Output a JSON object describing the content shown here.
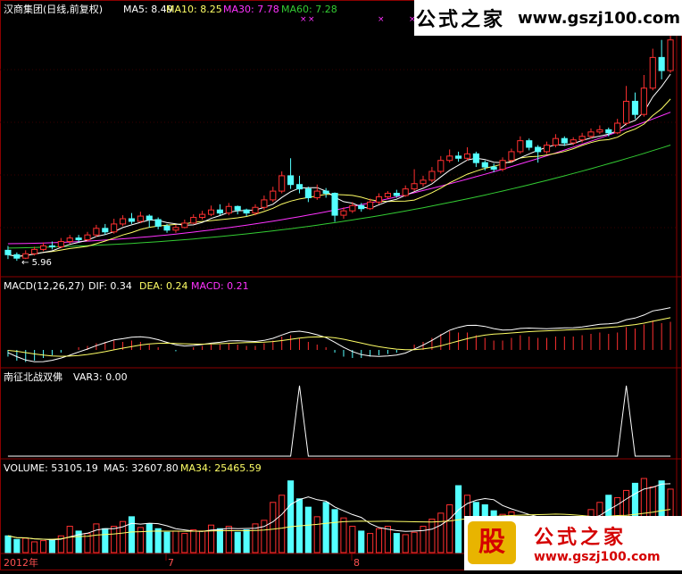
{
  "colors": {
    "background": "#000000",
    "border": "#8b0000",
    "up": "#ff3030",
    "down": "#54ffff",
    "ma5": "#ffffff",
    "ma10": "#ffff66",
    "ma30": "#ff33ff",
    "ma60": "#33cc33",
    "macd_hist": "#ff3030",
    "text_white": "#ffffff",
    "text_yellow": "#ffff66"
  },
  "panel_main": {
    "title": "汉商集团(日线,前复权)",
    "ma5": "MA5: 8.49",
    "ma10": "MA10: 8.25",
    "ma30": "MA30: 7.78",
    "ma60": "MA60: 7.28",
    "low_marker": "5.96",
    "cross_marks": [
      "×",
      "×",
      "×",
      "×"
    ]
  },
  "panel_macd": {
    "title": "MACD(12,26,27)",
    "dif": "DIF: 0.34",
    "dea": "DEA: 0.24",
    "macd": "MACD: 0.21"
  },
  "panel_var": {
    "title": "南征北战双佛",
    "var3": "VAR3: 0.00"
  },
  "panel_volume": {
    "vol": "VOLUME: 53105.19",
    "ma5": "MA5: 32607.80",
    "ma34": "MA34: 25465.59"
  },
  "axis_labels": [
    "2012年",
    "7",
    "8"
  ],
  "watermark_top": {
    "title": "公式之家",
    "url": "www.gszj100.com"
  },
  "watermark_bottom": {
    "badge": "股",
    "title": "公式之家",
    "url": "www.gszj100.com"
  },
  "chart_data": {
    "type": "candlestick",
    "ma_values": {
      "ma5": 8.49,
      "ma10": 8.25,
      "ma30": 7.78,
      "ma60": 7.28
    },
    "low_price": 5.96,
    "candles": [
      {
        "o": 6.2,
        "c": 6.1,
        "h": 6.3,
        "l": 6.0
      },
      {
        "o": 6.1,
        "c": 6.02,
        "h": 6.15,
        "l": 5.96
      },
      {
        "o": 6.02,
        "c": 6.12,
        "h": 6.2,
        "l": 6.0
      },
      {
        "o": 6.12,
        "c": 6.22,
        "h": 6.28,
        "l": 6.08
      },
      {
        "o": 6.22,
        "c": 6.3,
        "h": 6.38,
        "l": 6.18
      },
      {
        "o": 6.3,
        "c": 6.28,
        "h": 6.4,
        "l": 6.22
      },
      {
        "o": 6.28,
        "c": 6.4,
        "h": 6.48,
        "l": 6.25
      },
      {
        "o": 6.4,
        "c": 6.48,
        "h": 6.55,
        "l": 6.35
      },
      {
        "o": 6.48,
        "c": 6.44,
        "h": 6.55,
        "l": 6.38
      },
      {
        "o": 6.44,
        "c": 6.55,
        "h": 6.62,
        "l": 6.4
      },
      {
        "o": 6.55,
        "c": 6.7,
        "h": 6.78,
        "l": 6.5
      },
      {
        "o": 6.7,
        "c": 6.62,
        "h": 6.8,
        "l": 6.55
      },
      {
        "o": 6.62,
        "c": 6.8,
        "h": 6.92,
        "l": 6.58
      },
      {
        "o": 6.8,
        "c": 6.92,
        "h": 7.0,
        "l": 6.75
      },
      {
        "o": 6.92,
        "c": 6.86,
        "h": 7.05,
        "l": 6.8
      },
      {
        "o": 6.86,
        "c": 6.98,
        "h": 7.08,
        "l": 6.82
      },
      {
        "o": 6.98,
        "c": 6.9,
        "h": 7.02,
        "l": 6.72
      },
      {
        "o": 6.9,
        "c": 6.75,
        "h": 6.95,
        "l": 6.68
      },
      {
        "o": 6.75,
        "c": 6.66,
        "h": 6.8,
        "l": 6.6
      },
      {
        "o": 6.66,
        "c": 6.72,
        "h": 6.78,
        "l": 6.6
      },
      {
        "o": 6.72,
        "c": 6.82,
        "h": 6.9,
        "l": 6.7
      },
      {
        "o": 6.82,
        "c": 6.95,
        "h": 7.02,
        "l": 6.8
      },
      {
        "o": 6.95,
        "c": 7.02,
        "h": 7.1,
        "l": 6.9
      },
      {
        "o": 7.02,
        "c": 7.12,
        "h": 7.22,
        "l": 6.98
      },
      {
        "o": 7.12,
        "c": 7.05,
        "h": 7.25,
        "l": 7.0
      },
      {
        "o": 7.05,
        "c": 7.2,
        "h": 7.28,
        "l": 7.0
      },
      {
        "o": 7.2,
        "c": 7.12,
        "h": 7.22,
        "l": 7.02
      },
      {
        "o": 7.12,
        "c": 7.05,
        "h": 7.15,
        "l": 6.98
      },
      {
        "o": 7.05,
        "c": 7.18,
        "h": 7.25,
        "l": 7.0
      },
      {
        "o": 7.18,
        "c": 7.35,
        "h": 7.45,
        "l": 7.12
      },
      {
        "o": 7.35,
        "c": 7.55,
        "h": 7.65,
        "l": 7.3
      },
      {
        "o": 7.55,
        "c": 7.9,
        "h": 8.0,
        "l": 7.5
      },
      {
        "o": 7.9,
        "c": 7.7,
        "h": 8.3,
        "l": 7.6
      },
      {
        "o": 7.7,
        "c": 7.6,
        "h": 7.9,
        "l": 7.5
      },
      {
        "o": 7.6,
        "c": 7.4,
        "h": 7.65,
        "l": 7.3
      },
      {
        "o": 7.4,
        "c": 7.55,
        "h": 7.7,
        "l": 7.35
      },
      {
        "o": 7.55,
        "c": 7.5,
        "h": 7.62,
        "l": 7.4
      },
      {
        "o": 7.5,
        "c": 7.0,
        "h": 7.52,
        "l": 6.85
      },
      {
        "o": 7.0,
        "c": 7.1,
        "h": 7.18,
        "l": 6.92
      },
      {
        "o": 7.1,
        "c": 7.22,
        "h": 7.3,
        "l": 7.05
      },
      {
        "o": 7.22,
        "c": 7.15,
        "h": 7.28,
        "l": 7.08
      },
      {
        "o": 7.15,
        "c": 7.3,
        "h": 7.38,
        "l": 7.12
      },
      {
        "o": 7.3,
        "c": 7.42,
        "h": 7.5,
        "l": 7.25
      },
      {
        "o": 7.42,
        "c": 7.5,
        "h": 7.55,
        "l": 7.38
      },
      {
        "o": 7.5,
        "c": 7.45,
        "h": 7.58,
        "l": 7.4
      },
      {
        "o": 7.45,
        "c": 7.6,
        "h": 7.68,
        "l": 7.42
      },
      {
        "o": 7.6,
        "c": 7.72,
        "h": 8.05,
        "l": 7.55
      },
      {
        "o": 7.72,
        "c": 7.8,
        "h": 7.9,
        "l": 7.65
      },
      {
        "o": 7.8,
        "c": 8.0,
        "h": 8.1,
        "l": 7.75
      },
      {
        "o": 8.0,
        "c": 8.25,
        "h": 8.35,
        "l": 7.95
      },
      {
        "o": 8.25,
        "c": 8.35,
        "h": 8.5,
        "l": 8.2
      },
      {
        "o": 8.35,
        "c": 8.3,
        "h": 8.45,
        "l": 8.22
      },
      {
        "o": 8.3,
        "c": 8.4,
        "h": 8.55,
        "l": 8.25
      },
      {
        "o": 8.4,
        "c": 8.2,
        "h": 8.45,
        "l": 8.1
      },
      {
        "o": 8.2,
        "c": 8.1,
        "h": 8.25,
        "l": 8.02
      },
      {
        "o": 8.1,
        "c": 8.05,
        "h": 8.18,
        "l": 7.98
      },
      {
        "o": 8.05,
        "c": 8.25,
        "h": 8.32,
        "l": 8.0
      },
      {
        "o": 8.25,
        "c": 8.45,
        "h": 8.52,
        "l": 8.2
      },
      {
        "o": 8.45,
        "c": 8.7,
        "h": 8.8,
        "l": 8.4
      },
      {
        "o": 8.7,
        "c": 8.55,
        "h": 8.75,
        "l": 8.48
      },
      {
        "o": 8.55,
        "c": 8.45,
        "h": 8.6,
        "l": 8.2
      },
      {
        "o": 8.45,
        "c": 8.6,
        "h": 8.68,
        "l": 8.4
      },
      {
        "o": 8.6,
        "c": 8.75,
        "h": 8.85,
        "l": 8.55
      },
      {
        "o": 8.75,
        "c": 8.65,
        "h": 8.8,
        "l": 8.58
      },
      {
        "o": 8.65,
        "c": 8.72,
        "h": 8.78,
        "l": 8.6
      },
      {
        "o": 8.72,
        "c": 8.8,
        "h": 8.88,
        "l": 8.66
      },
      {
        "o": 8.8,
        "c": 8.9,
        "h": 8.98,
        "l": 8.75
      },
      {
        "o": 8.9,
        "c": 8.95,
        "h": 9.05,
        "l": 8.85
      },
      {
        "o": 8.95,
        "c": 8.88,
        "h": 9.0,
        "l": 8.8
      },
      {
        "o": 8.88,
        "c": 9.1,
        "h": 9.2,
        "l": 8.85
      },
      {
        "o": 9.1,
        "c": 9.6,
        "h": 9.95,
        "l": 9.05
      },
      {
        "o": 9.6,
        "c": 9.3,
        "h": 9.8,
        "l": 9.2
      },
      {
        "o": 9.3,
        "c": 9.9,
        "h": 10.2,
        "l": 9.25
      },
      {
        "o": 9.9,
        "c": 10.6,
        "h": 10.8,
        "l": 9.85
      },
      {
        "o": 10.6,
        "c": 10.3,
        "h": 11.0,
        "l": 10.1
      },
      {
        "o": 10.3,
        "c": 11.0,
        "h": 11.2,
        "l": 10.25
      }
    ],
    "macd_hist": [
      -0.05,
      -0.08,
      -0.09,
      -0.08,
      -0.06,
      -0.04,
      -0.02,
      0.0,
      0.02,
      0.03,
      0.05,
      0.06,
      0.07,
      0.06,
      0.07,
      0.06,
      0.04,
      0.02,
      0.0,
      -0.01,
      0.0,
      0.02,
      0.03,
      0.04,
      0.04,
      0.05,
      0.04,
      0.03,
      0.03,
      0.05,
      0.07,
      0.1,
      0.11,
      0.09,
      0.06,
      0.04,
      0.02,
      -0.02,
      -0.05,
      -0.06,
      -0.06,
      -0.05,
      -0.04,
      -0.03,
      -0.02,
      0.0,
      0.04,
      0.06,
      0.09,
      0.12,
      0.14,
      0.13,
      0.13,
      0.11,
      0.09,
      0.07,
      0.07,
      0.09,
      0.11,
      0.1,
      0.09,
      0.09,
      0.1,
      0.1,
      0.1,
      0.11,
      0.12,
      0.13,
      0.12,
      0.13,
      0.17,
      0.16,
      0.19,
      0.22,
      0.2,
      0.21
    ],
    "var3_peaks": [
      33,
      70
    ],
    "volume": [
      14000,
      11000,
      12000,
      9000,
      10000,
      11000,
      14000,
      22000,
      18000,
      16000,
      24000,
      20000,
      22000,
      26000,
      30000,
      21000,
      24000,
      20000,
      17000,
      18000,
      16000,
      19000,
      18000,
      23000,
      20000,
      22000,
      17000,
      19000,
      24000,
      27000,
      42000,
      48000,
      60000,
      45000,
      38000,
      30000,
      42000,
      36000,
      29000,
      22000,
      18000,
      16000,
      20000,
      22000,
      16000,
      15000,
      17000,
      22000,
      28000,
      33000,
      40000,
      56000,
      48000,
      42000,
      40000,
      35000,
      32000,
      34000,
      30000,
      28000,
      26000,
      27000,
      30000,
      24000,
      25000,
      28000,
      36000,
      42000,
      48000,
      46000,
      52000,
      58000,
      62000,
      55000,
      60000,
      53105
    ],
    "volume_ma5": 32607.8,
    "volume_ma34": 25465.59
  }
}
